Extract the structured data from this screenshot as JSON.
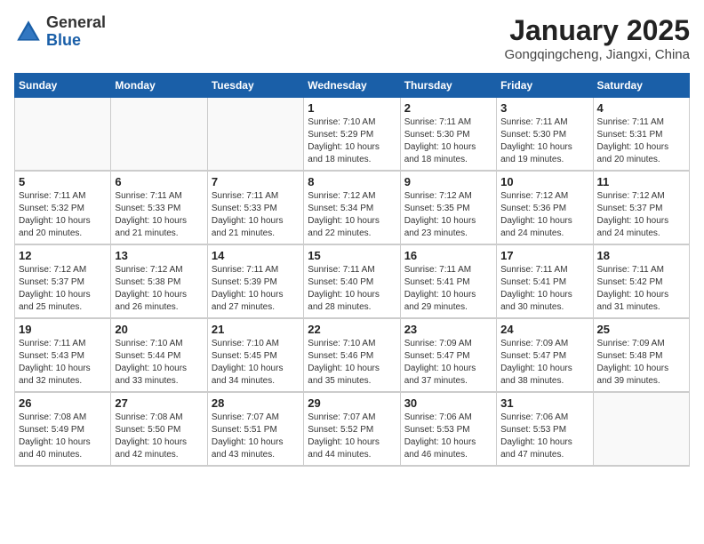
{
  "header": {
    "logo_general": "General",
    "logo_blue": "Blue",
    "title": "January 2025",
    "location": "Gongqingcheng, Jiangxi, China"
  },
  "days_of_week": [
    "Sunday",
    "Monday",
    "Tuesday",
    "Wednesday",
    "Thursday",
    "Friday",
    "Saturday"
  ],
  "weeks": [
    [
      {
        "day": "",
        "info": ""
      },
      {
        "day": "",
        "info": ""
      },
      {
        "day": "",
        "info": ""
      },
      {
        "day": "1",
        "info": "Sunrise: 7:10 AM\nSunset: 5:29 PM\nDaylight: 10 hours\nand 18 minutes."
      },
      {
        "day": "2",
        "info": "Sunrise: 7:11 AM\nSunset: 5:30 PM\nDaylight: 10 hours\nand 18 minutes."
      },
      {
        "day": "3",
        "info": "Sunrise: 7:11 AM\nSunset: 5:30 PM\nDaylight: 10 hours\nand 19 minutes."
      },
      {
        "day": "4",
        "info": "Sunrise: 7:11 AM\nSunset: 5:31 PM\nDaylight: 10 hours\nand 20 minutes."
      }
    ],
    [
      {
        "day": "5",
        "info": "Sunrise: 7:11 AM\nSunset: 5:32 PM\nDaylight: 10 hours\nand 20 minutes."
      },
      {
        "day": "6",
        "info": "Sunrise: 7:11 AM\nSunset: 5:33 PM\nDaylight: 10 hours\nand 21 minutes."
      },
      {
        "day": "7",
        "info": "Sunrise: 7:11 AM\nSunset: 5:33 PM\nDaylight: 10 hours\nand 21 minutes."
      },
      {
        "day": "8",
        "info": "Sunrise: 7:12 AM\nSunset: 5:34 PM\nDaylight: 10 hours\nand 22 minutes."
      },
      {
        "day": "9",
        "info": "Sunrise: 7:12 AM\nSunset: 5:35 PM\nDaylight: 10 hours\nand 23 minutes."
      },
      {
        "day": "10",
        "info": "Sunrise: 7:12 AM\nSunset: 5:36 PM\nDaylight: 10 hours\nand 24 minutes."
      },
      {
        "day": "11",
        "info": "Sunrise: 7:12 AM\nSunset: 5:37 PM\nDaylight: 10 hours\nand 24 minutes."
      }
    ],
    [
      {
        "day": "12",
        "info": "Sunrise: 7:12 AM\nSunset: 5:37 PM\nDaylight: 10 hours\nand 25 minutes."
      },
      {
        "day": "13",
        "info": "Sunrise: 7:12 AM\nSunset: 5:38 PM\nDaylight: 10 hours\nand 26 minutes."
      },
      {
        "day": "14",
        "info": "Sunrise: 7:11 AM\nSunset: 5:39 PM\nDaylight: 10 hours\nand 27 minutes."
      },
      {
        "day": "15",
        "info": "Sunrise: 7:11 AM\nSunset: 5:40 PM\nDaylight: 10 hours\nand 28 minutes."
      },
      {
        "day": "16",
        "info": "Sunrise: 7:11 AM\nSunset: 5:41 PM\nDaylight: 10 hours\nand 29 minutes."
      },
      {
        "day": "17",
        "info": "Sunrise: 7:11 AM\nSunset: 5:41 PM\nDaylight: 10 hours\nand 30 minutes."
      },
      {
        "day": "18",
        "info": "Sunrise: 7:11 AM\nSunset: 5:42 PM\nDaylight: 10 hours\nand 31 minutes."
      }
    ],
    [
      {
        "day": "19",
        "info": "Sunrise: 7:11 AM\nSunset: 5:43 PM\nDaylight: 10 hours\nand 32 minutes."
      },
      {
        "day": "20",
        "info": "Sunrise: 7:10 AM\nSunset: 5:44 PM\nDaylight: 10 hours\nand 33 minutes."
      },
      {
        "day": "21",
        "info": "Sunrise: 7:10 AM\nSunset: 5:45 PM\nDaylight: 10 hours\nand 34 minutes."
      },
      {
        "day": "22",
        "info": "Sunrise: 7:10 AM\nSunset: 5:46 PM\nDaylight: 10 hours\nand 35 minutes."
      },
      {
        "day": "23",
        "info": "Sunrise: 7:09 AM\nSunset: 5:47 PM\nDaylight: 10 hours\nand 37 minutes."
      },
      {
        "day": "24",
        "info": "Sunrise: 7:09 AM\nSunset: 5:47 PM\nDaylight: 10 hours\nand 38 minutes."
      },
      {
        "day": "25",
        "info": "Sunrise: 7:09 AM\nSunset: 5:48 PM\nDaylight: 10 hours\nand 39 minutes."
      }
    ],
    [
      {
        "day": "26",
        "info": "Sunrise: 7:08 AM\nSunset: 5:49 PM\nDaylight: 10 hours\nand 40 minutes."
      },
      {
        "day": "27",
        "info": "Sunrise: 7:08 AM\nSunset: 5:50 PM\nDaylight: 10 hours\nand 42 minutes."
      },
      {
        "day": "28",
        "info": "Sunrise: 7:07 AM\nSunset: 5:51 PM\nDaylight: 10 hours\nand 43 minutes."
      },
      {
        "day": "29",
        "info": "Sunrise: 7:07 AM\nSunset: 5:52 PM\nDaylight: 10 hours\nand 44 minutes."
      },
      {
        "day": "30",
        "info": "Sunrise: 7:06 AM\nSunset: 5:53 PM\nDaylight: 10 hours\nand 46 minutes."
      },
      {
        "day": "31",
        "info": "Sunrise: 7:06 AM\nSunset: 5:53 PM\nDaylight: 10 hours\nand 47 minutes."
      },
      {
        "day": "",
        "info": ""
      }
    ]
  ]
}
